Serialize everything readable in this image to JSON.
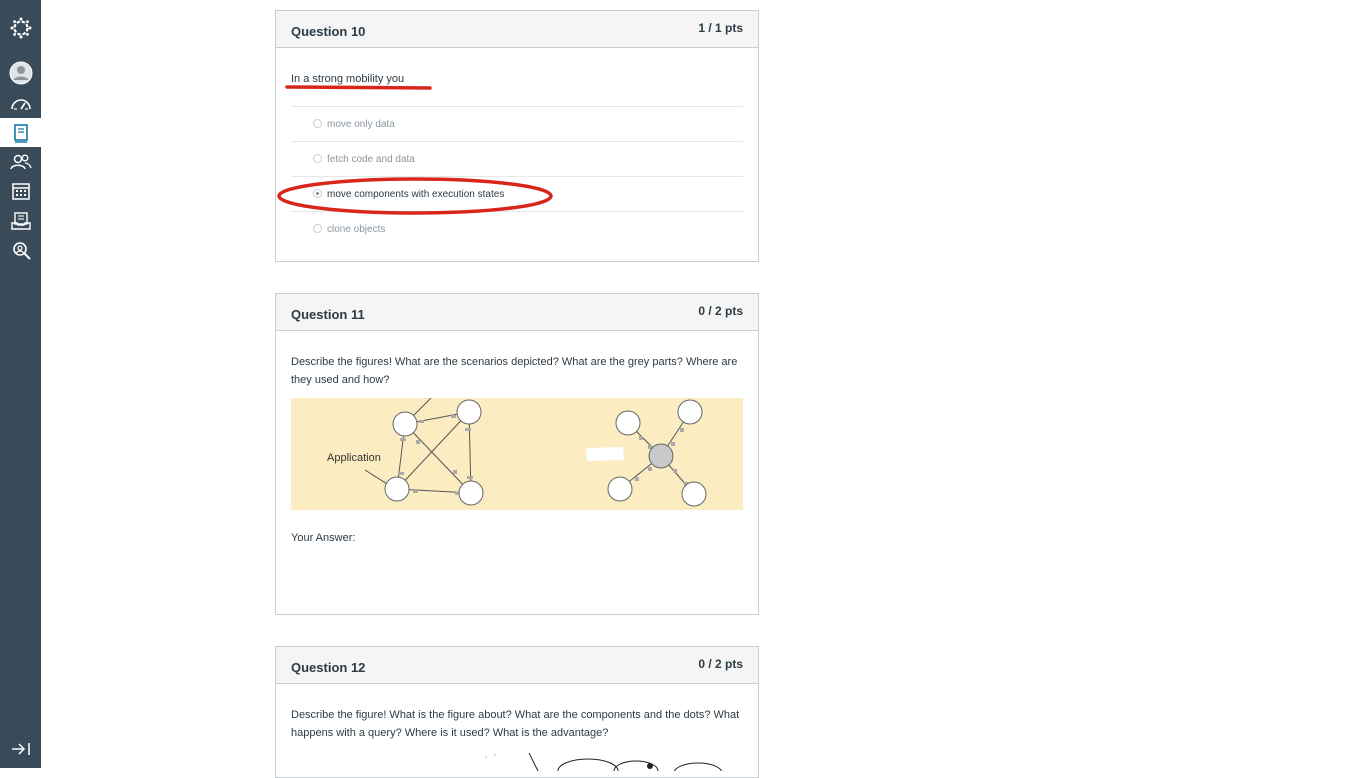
{
  "nav": [
    {
      "name": "logo",
      "icon": "canvas-logo-icon"
    },
    {
      "name": "account",
      "icon": "avatar-icon"
    },
    {
      "name": "dashboard",
      "icon": "dashboard-icon"
    },
    {
      "name": "courses",
      "icon": "book-icon",
      "active": true
    },
    {
      "name": "groups",
      "icon": "groups-icon"
    },
    {
      "name": "calendar",
      "icon": "calendar-icon"
    },
    {
      "name": "inbox",
      "icon": "inbox-icon"
    },
    {
      "name": "commons",
      "icon": "commons-icon"
    },
    {
      "name": "collapse",
      "icon": "collapse-arrow-icon"
    }
  ],
  "questions": [
    {
      "title": "Question 10",
      "points": "1 / 1 pts",
      "text": "In a strong mobility you",
      "answers": [
        {
          "label": "move only data",
          "selected": false
        },
        {
          "label": "fetch code and data",
          "selected": false
        },
        {
          "label": "move components with execution states",
          "selected": true
        },
        {
          "label": "clone objects",
          "selected": false
        }
      ]
    },
    {
      "title": "Question 11",
      "points": "0 / 2 pts",
      "text": "Describe the figures! What are the scenarios depicted? What are the grey parts? Where are they used and how?",
      "figure_label": "Application",
      "your_answer_label": "Your Answer:"
    },
    {
      "title": "Question 12",
      "points": "0 / 2 pts",
      "text": "Describe the figure! What is the figure about? What are the components and the dots? What happens with a query? Where is it used? What is the advantage?"
    }
  ],
  "colors": {
    "sidebar": "#394b58",
    "annotation_red": "#d9261c",
    "figure_bg": "#fbedc1"
  }
}
